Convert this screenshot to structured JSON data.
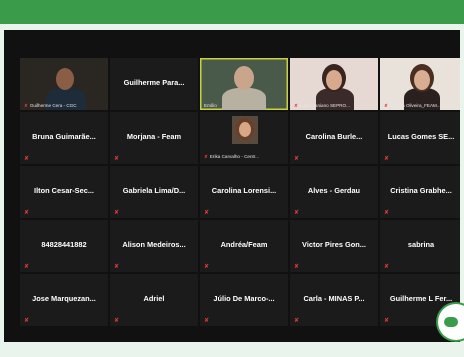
{
  "colors": {
    "top_bar": "#3a9b4a",
    "background": "#e9f5ec",
    "meeting_bg": "#111111",
    "tile_bg": "#1b1b1b",
    "mute_red": "#e23b3b",
    "active_speaker": "#c8d33a"
  },
  "grid": {
    "row1": {
      "t1_label": "Guilherme Cera - CGC",
      "t2_name": "Guilherme Para...",
      "t3_label": "Emílio",
      "t4_label": "Lucia Zaniano SEPRO...",
      "t5_label": "Larissa Oliveira_FEAM..."
    },
    "row2": {
      "t1_name": "Bruna Guimarãe...",
      "t2_name": "Morjana - Feam",
      "t3_label": "Erika Carvalho - Centr...",
      "t4_name": "Carolina Burle...",
      "t5_name": "Lucas Gomes SE..."
    },
    "row3": {
      "t1_name": "Ilton Cesar-Sec...",
      "t2_name": "Gabriela Lima/D...",
      "t3_name": "Carolina Lorensi...",
      "t4_name": "Alves - Gerdau",
      "t5_name": "Cristina Grabhe..."
    },
    "row4": {
      "t1_name": "84828441882",
      "t2_name": "Alison Medeiros...",
      "t3_name": "Andréa/Feam",
      "t4_name": "Victor Pires Gon...",
      "t5_name": "sabrina"
    },
    "row5": {
      "t1_name": "Jose Marquezan...",
      "t2_name": "Adriel",
      "t3_name": "Júlio De Marco-...",
      "t4_name": "Carla - MINAS P...",
      "t5_name": "Guilherme L Fer..."
    }
  },
  "icons": {
    "mute": "muted-mic-icon",
    "mute_glyph": "✘"
  }
}
